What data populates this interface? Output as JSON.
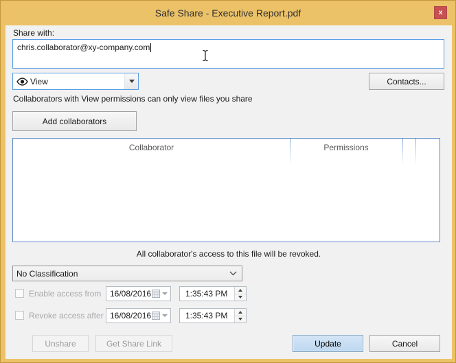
{
  "window": {
    "title": "Safe Share - Executive Report.pdf",
    "close_glyph": "x"
  },
  "share": {
    "label": "Share with:",
    "recipient_value": "chris.collaborator@xy-company.com",
    "permission_selected": "View",
    "contacts_button": "Contacts...",
    "hint": "Collaborators with View permissions can only view files you share",
    "add_collaborators_button": "Add collaborators"
  },
  "collaborators_table": {
    "columns": [
      "Collaborator",
      "Permissions"
    ],
    "rows": [],
    "note": "All collaborator's access to this file will be revoked."
  },
  "classification": {
    "selected": "No Classification"
  },
  "schedule": {
    "enable_from": {
      "label": "Enable access from",
      "checked": false,
      "date": "16/08/2016",
      "time": "1:35:43 PM"
    },
    "revoke_after": {
      "label": "Revoke access after",
      "checked": false,
      "date": "16/08/2016",
      "time": "1:35:43 PM"
    }
  },
  "footer": {
    "unshare_button": "Unshare",
    "get_share_link_button": "Get Share Link",
    "update_button": "Update",
    "cancel_button": "Cancel"
  },
  "colors": {
    "titlebar_gold": "#ecc268",
    "close_red": "#c75050",
    "input_border_blue": "#569de5",
    "table_border_blue": "#5a87c5",
    "update_fill_blue": "#c5dcf3",
    "dialog_bg": "#f1f1f1"
  }
}
